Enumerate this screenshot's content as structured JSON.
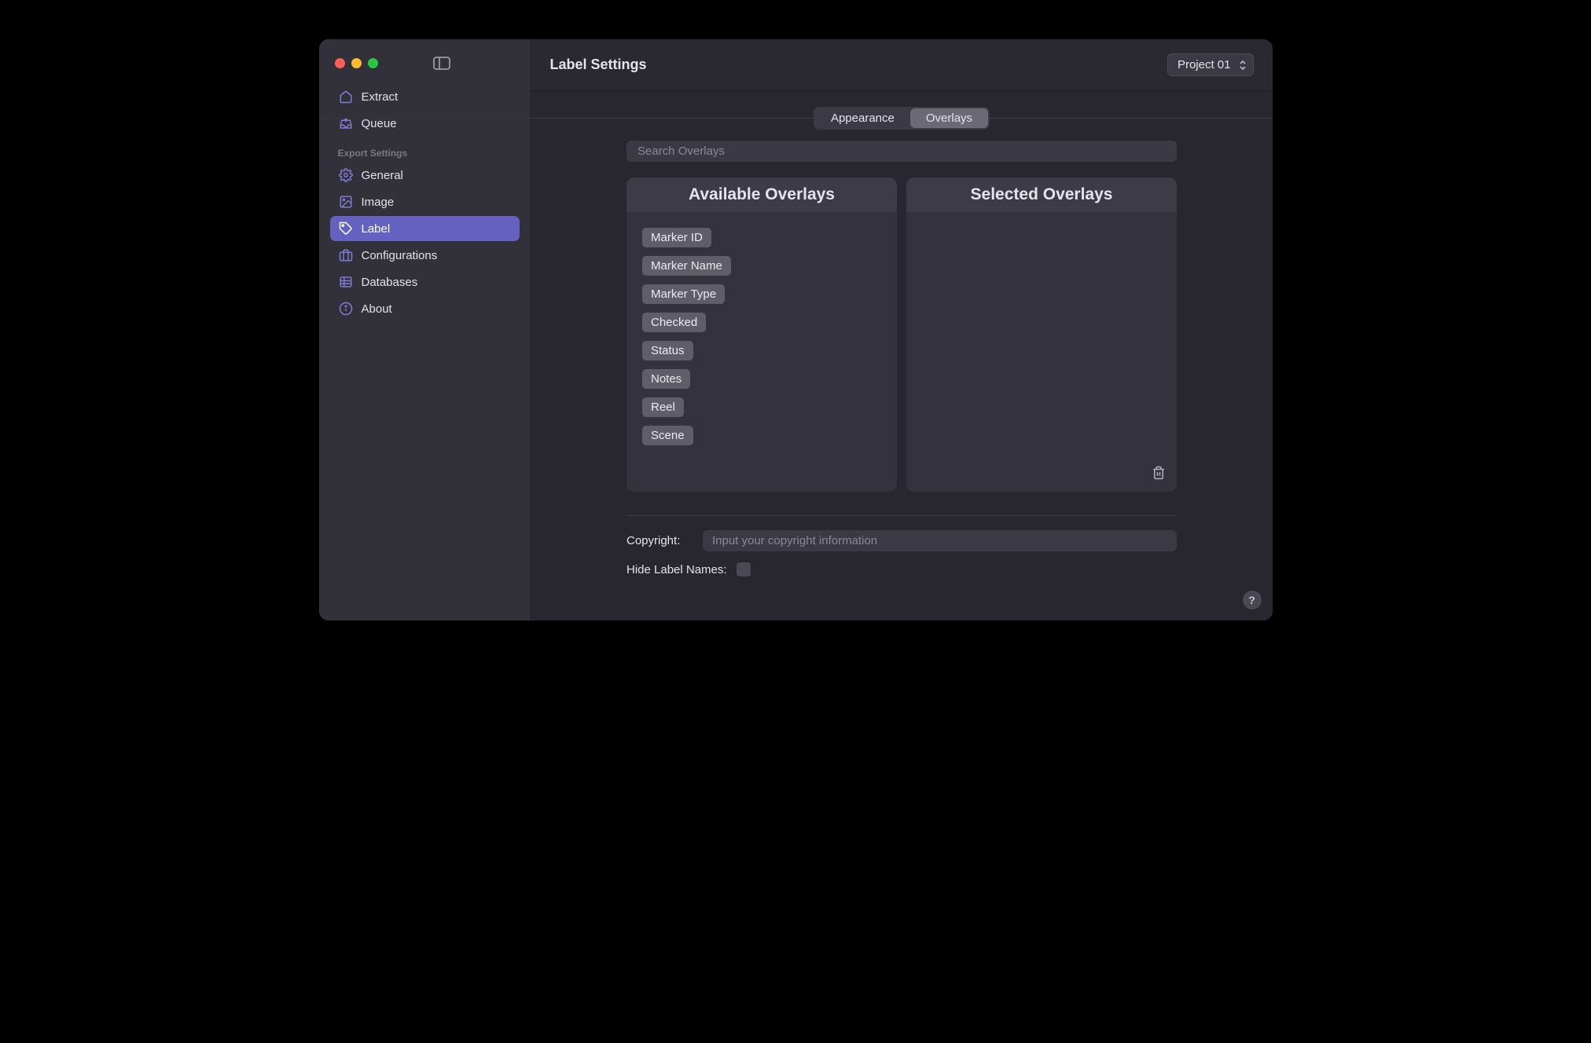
{
  "header": {
    "title": "Label Settings",
    "project": "Project 01"
  },
  "sidebar": {
    "top": [
      {
        "label": "Extract",
        "icon": "home"
      },
      {
        "label": "Queue",
        "icon": "tray"
      }
    ],
    "section_label": "Export Settings",
    "settings": [
      {
        "label": "General",
        "icon": "gear"
      },
      {
        "label": "Image",
        "icon": "image"
      },
      {
        "label": "Label",
        "icon": "tag",
        "active": true
      },
      {
        "label": "Configurations",
        "icon": "briefcase"
      },
      {
        "label": "Databases",
        "icon": "database"
      },
      {
        "label": "About",
        "icon": "info"
      }
    ]
  },
  "tabs": {
    "items": [
      "Appearance",
      "Overlays"
    ],
    "active": "Overlays"
  },
  "search": {
    "placeholder": "Search Overlays"
  },
  "panels": {
    "available_title": "Available Overlays",
    "selected_title": "Selected Overlays",
    "available_items": [
      "Marker ID",
      "Marker Name",
      "Marker Type",
      "Checked",
      "Status",
      "Notes",
      "Reel",
      "Scene"
    ]
  },
  "form": {
    "copyright_label": "Copyright:",
    "copyright_placeholder": "Input your copyright information",
    "hide_label": "Hide Label Names:"
  },
  "colors": {
    "accent": "#6561c0"
  }
}
